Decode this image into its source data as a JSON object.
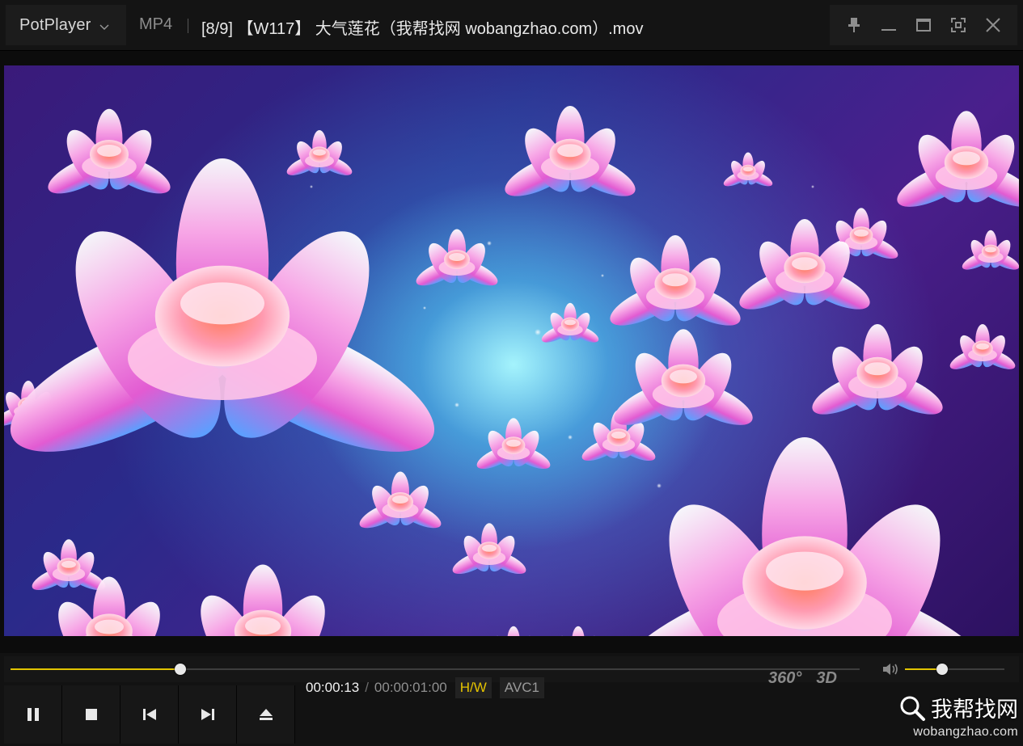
{
  "titlebar": {
    "app_name": "PotPlayer",
    "format": "MP4",
    "file_title": "[8/9] 【W117】 大气莲花（我帮找网 wobangzhao.com）.mov"
  },
  "playback": {
    "current_time": "00:00:13",
    "separator": "/",
    "total_time": "00:00:01:00",
    "hw_badge": "H/W",
    "codec_badge": "AVC1",
    "progress": 0.2,
    "volume": 0.37
  },
  "toolbar": {
    "btn_360": "360°",
    "btn_3d": "3D"
  },
  "watermark": {
    "name": "我帮找网",
    "url": "wobangzhao.com"
  },
  "colors": {
    "accent": "#e2c400",
    "background": "#121212"
  }
}
